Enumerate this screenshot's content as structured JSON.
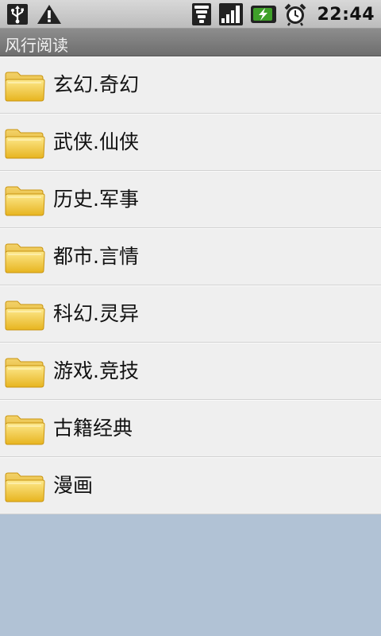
{
  "status_bar": {
    "icons_left": [
      "usb-icon",
      "warning-icon"
    ],
    "icons_right": [
      "wifi-icon",
      "signal-icon",
      "battery-charging-icon",
      "alarm-clock-icon"
    ],
    "time": "22:44"
  },
  "app": {
    "title": "风行阅读"
  },
  "categories": [
    {
      "label": "玄幻.奇幻",
      "icon": "folder-icon"
    },
    {
      "label": "武侠.仙侠",
      "icon": "folder-icon"
    },
    {
      "label": "历史.军事",
      "icon": "folder-icon"
    },
    {
      "label": "都市.言情",
      "icon": "folder-icon"
    },
    {
      "label": "科幻.灵异",
      "icon": "folder-icon"
    },
    {
      "label": "游戏.竞技",
      "icon": "folder-icon"
    },
    {
      "label": "古籍经典",
      "icon": "folder-icon"
    },
    {
      "label": "漫画",
      "icon": "folder-icon"
    }
  ],
  "colors": {
    "status_bar": "#c9c9c9",
    "title_bar": "#7a7a7a",
    "list_background": "#efefef",
    "empty_background": "#b1c2d5",
    "folder": "#e9bd2a",
    "battery": "#3fa02a"
  }
}
